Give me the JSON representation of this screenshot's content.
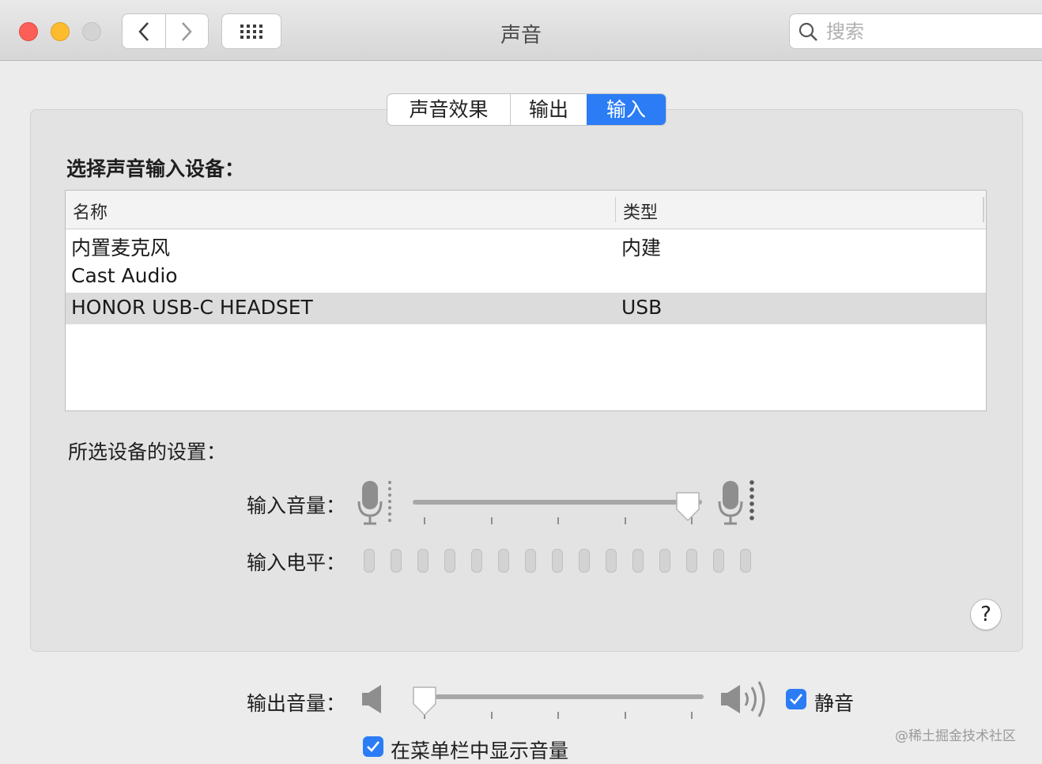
{
  "window": {
    "title": "声音"
  },
  "search": {
    "placeholder": "搜索"
  },
  "tabs": [
    {
      "label": "声音效果",
      "selected": false
    },
    {
      "label": "输出",
      "selected": false
    },
    {
      "label": "输入",
      "selected": true
    }
  ],
  "input_devices": {
    "heading": "选择声音输入设备：",
    "columns": [
      "名称",
      "类型"
    ],
    "rows": [
      {
        "name": "内置麦克风",
        "type": "内建"
      },
      {
        "name": "Cast Audio",
        "type": ""
      },
      {
        "name": "HONOR USB-C HEADSET",
        "type": "USB",
        "selected": true
      }
    ]
  },
  "settings": {
    "heading": "所选设备的设置：",
    "input_volume_label": "输入音量：",
    "input_volume_fraction": 0.95,
    "input_level_label": "输入电平：",
    "input_level_segments": 15,
    "input_level_active": 0
  },
  "output": {
    "volume_label": "输出音量：",
    "volume_fraction": 0.04,
    "mute_label": "静音",
    "mute_checked": true,
    "show_in_menubar_label": "在菜单栏中显示音量",
    "show_in_menubar_checked": true
  },
  "help_label": "?",
  "watermark": "@稀土掘金技术社区",
  "colors": {
    "accent": "#2b7cf5",
    "close": "#fc5f57",
    "minimize": "#fdbc2e"
  }
}
